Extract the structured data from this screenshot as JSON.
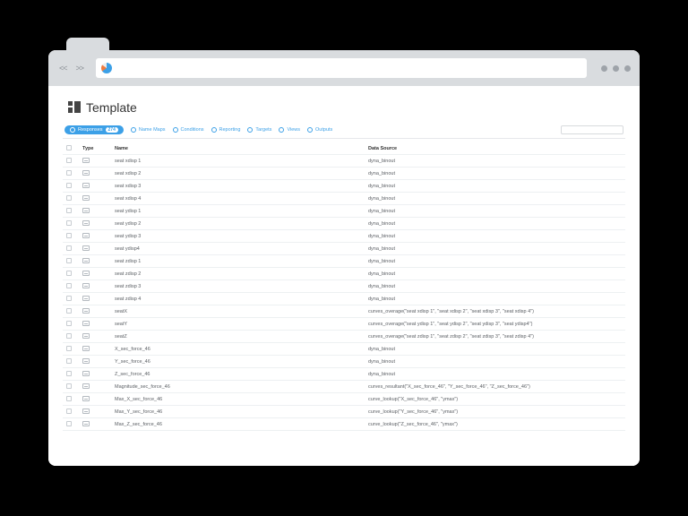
{
  "page": {
    "title": "Template"
  },
  "tabs": [
    {
      "label": "Responses",
      "badge": "274",
      "active": true
    },
    {
      "label": "Name Maps"
    },
    {
      "label": "Conditions"
    },
    {
      "label": "Reporting"
    },
    {
      "label": "Targets"
    },
    {
      "label": "Views"
    },
    {
      "label": "Outputs"
    }
  ],
  "search": {
    "placeholder": ""
  },
  "columns": {
    "type": "Type",
    "name": "Name",
    "data_source": "Data Source"
  },
  "rows": [
    {
      "name": "seat xdisp 1",
      "ds": "dyna_binout"
    },
    {
      "name": "seat xdisp 2",
      "ds": "dyna_binout"
    },
    {
      "name": "seat xdisp 3",
      "ds": "dyna_binout"
    },
    {
      "name": "seat xdisp 4",
      "ds": "dyna_binout"
    },
    {
      "name": "seat ydisp 1",
      "ds": "dyna_binout"
    },
    {
      "name": "seat ydisp 2",
      "ds": "dyna_binout"
    },
    {
      "name": "seat ydisp 3",
      "ds": "dyna_binout"
    },
    {
      "name": "seat ydisp4",
      "ds": "dyna_binout"
    },
    {
      "name": "seat zdisp 1",
      "ds": "dyna_binout"
    },
    {
      "name": "seat zdisp 2",
      "ds": "dyna_binout"
    },
    {
      "name": "seat zdisp 3",
      "ds": "dyna_binout"
    },
    {
      "name": "seat zdisp 4",
      "ds": "dyna_binout"
    },
    {
      "name": "seatX",
      "ds": "curves_overage(\"seat xdisp 1\", \"seat xdisp 2\", \"seat xdisp 3\", \"seat xdisp 4\")"
    },
    {
      "name": "seatY",
      "ds": "curves_overage(\"seat ydisp 1\", \"seat ydisp 2\", \"seat ydisp 3\", \"seat ydisp4\")"
    },
    {
      "name": "seatZ",
      "ds": "curves_overage(\"seat zdisp 1\", \"seat zdisp 2\", \"seat zdisp 3\", \"seat zdisp 4\")"
    },
    {
      "name": "X_sec_force_46",
      "ds": "dyna_binout"
    },
    {
      "name": "Y_sec_force_46",
      "ds": "dyna_binout"
    },
    {
      "name": "Z_sec_force_46",
      "ds": "dyna_binout"
    },
    {
      "name": "Magnitude_sec_force_46",
      "ds": "curves_resultant(\"X_sec_force_46\", \"Y_sec_force_46\", \"Z_sec_force_46\")"
    },
    {
      "name": "Max_X_sec_force_46",
      "ds": "curve_lookup(\"X_sec_force_46\", \"ymax\")"
    },
    {
      "name": "Max_Y_sec_force_46",
      "ds": "curve_lookup(\"Y_sec_force_46\", \"ymax\")"
    },
    {
      "name": "Max_Z_sec_force_46",
      "ds": "curve_lookup(\"Z_sec_force_46\", \"ymax\")"
    }
  ]
}
